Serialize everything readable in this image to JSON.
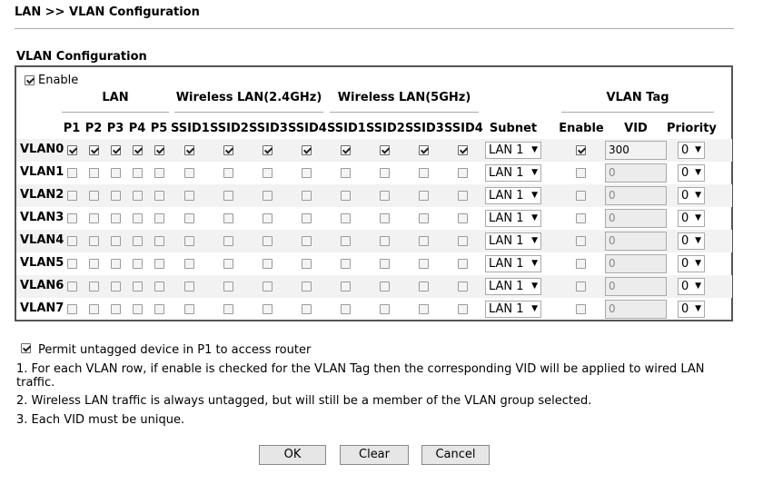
{
  "breadcrumb": "LAN >> VLAN Configuration",
  "section_title": "VLAN Configuration",
  "enable_label": "Enable",
  "enable_checked": true,
  "group_headers": {
    "lan": "LAN",
    "wlan24": "Wireless LAN(2.4GHz)",
    "wlan5": "Wireless LAN(5GHz)",
    "vlan_tag": "VLAN Tag"
  },
  "columns": {
    "ports": [
      "P1",
      "P2",
      "P3",
      "P4",
      "P5"
    ],
    "ssid24": [
      "SSID1",
      "SSID2",
      "SSID3",
      "SSID4"
    ],
    "ssid5": [
      "SSID1",
      "SSID2",
      "SSID3",
      "SSID4"
    ],
    "subnet": "Subnet",
    "tag_enable": "Enable",
    "vid": "VID",
    "priority": "Priority"
  },
  "rows": [
    {
      "name": "VLAN0",
      "ports": [
        true,
        true,
        true,
        true,
        true
      ],
      "ssid24": [
        true,
        true,
        true,
        true
      ],
      "ssid5": [
        true,
        true,
        true,
        true
      ],
      "subnet": "LAN 1",
      "tag_enable": true,
      "vid": "300",
      "vid_enabled": true,
      "priority": "0"
    },
    {
      "name": "VLAN1",
      "ports": [
        false,
        false,
        false,
        false,
        false
      ],
      "ssid24": [
        false,
        false,
        false,
        false
      ],
      "ssid5": [
        false,
        false,
        false,
        false
      ],
      "subnet": "LAN 1",
      "tag_enable": false,
      "vid": "0",
      "vid_enabled": false,
      "priority": "0"
    },
    {
      "name": "VLAN2",
      "ports": [
        false,
        false,
        false,
        false,
        false
      ],
      "ssid24": [
        false,
        false,
        false,
        false
      ],
      "ssid5": [
        false,
        false,
        false,
        false
      ],
      "subnet": "LAN 1",
      "tag_enable": false,
      "vid": "0",
      "vid_enabled": false,
      "priority": "0"
    },
    {
      "name": "VLAN3",
      "ports": [
        false,
        false,
        false,
        false,
        false
      ],
      "ssid24": [
        false,
        false,
        false,
        false
      ],
      "ssid5": [
        false,
        false,
        false,
        false
      ],
      "subnet": "LAN 1",
      "tag_enable": false,
      "vid": "0",
      "vid_enabled": false,
      "priority": "0"
    },
    {
      "name": "VLAN4",
      "ports": [
        false,
        false,
        false,
        false,
        false
      ],
      "ssid24": [
        false,
        false,
        false,
        false
      ],
      "ssid5": [
        false,
        false,
        false,
        false
      ],
      "subnet": "LAN 1",
      "tag_enable": false,
      "vid": "0",
      "vid_enabled": false,
      "priority": "0"
    },
    {
      "name": "VLAN5",
      "ports": [
        false,
        false,
        false,
        false,
        false
      ],
      "ssid24": [
        false,
        false,
        false,
        false
      ],
      "ssid5": [
        false,
        false,
        false,
        false
      ],
      "subnet": "LAN 1",
      "tag_enable": false,
      "vid": "0",
      "vid_enabled": false,
      "priority": "0"
    },
    {
      "name": "VLAN6",
      "ports": [
        false,
        false,
        false,
        false,
        false
      ],
      "ssid24": [
        false,
        false,
        false,
        false
      ],
      "ssid5": [
        false,
        false,
        false,
        false
      ],
      "subnet": "LAN 1",
      "tag_enable": false,
      "vid": "0",
      "vid_enabled": false,
      "priority": "0"
    },
    {
      "name": "VLAN7",
      "ports": [
        false,
        false,
        false,
        false,
        false
      ],
      "ssid24": [
        false,
        false,
        false,
        false
      ],
      "ssid5": [
        false,
        false,
        false,
        false
      ],
      "subnet": "LAN 1",
      "tag_enable": false,
      "vid": "0",
      "vid_enabled": false,
      "priority": "0"
    }
  ],
  "permit_checked": true,
  "permit_label": "Permit untagged device in P1 to access router",
  "notes": [
    "1. For each VLAN row, if enable is checked for the VLAN Tag then the corresponding VID will be applied to wired LAN",
    "traffic.",
    "2. Wireless LAN traffic is always untagged, but will still be a member of the VLAN group selected.",
    "3. Each VID must be unique."
  ],
  "buttons": {
    "ok": "OK",
    "clear": "Clear",
    "cancel": "Cancel"
  }
}
